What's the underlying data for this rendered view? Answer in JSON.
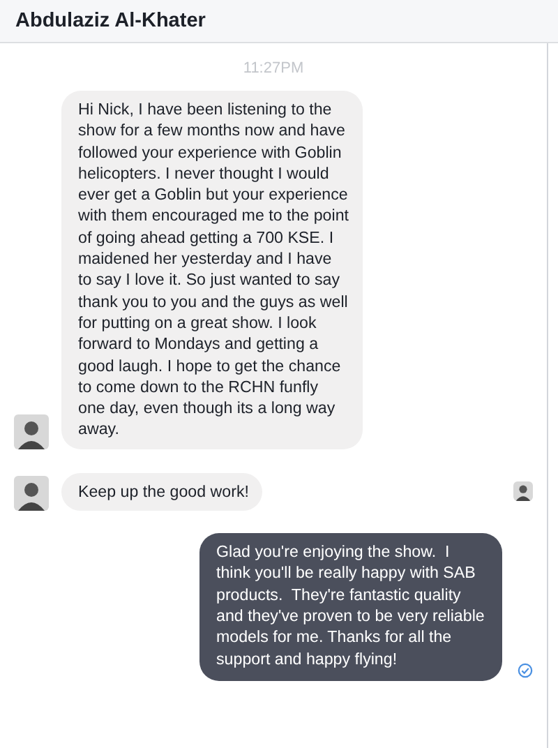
{
  "header": {
    "title": "Abdulaziz Al-Khater"
  },
  "timestamp": "11:27PM",
  "messages": [
    {
      "kind": "incoming",
      "avatar": true,
      "text": "Hi Nick, I have been listening to the show for a few months now and have followed your experience with Goblin helicopters. I never thought I would ever get a Goblin but your experience with them encouraged me to the point of going ahead getting a 700 KSE. I maidened her yesterday and I have to say I love it. So just wanted to say thank you to you and the guys as well for putting on a great show. I look forward to Mondays and getting a good laugh. I hope to get the chance to come down to the RCHN funfly one day, even though its a long way away."
    },
    {
      "kind": "incoming",
      "avatar": true,
      "seen": true,
      "text": "Keep up the good work!"
    },
    {
      "kind": "outgoing",
      "delivered": true,
      "text": "Glad you're enjoying the show.  I think you'll be really happy with SAB products.  They're fantastic quality and they've proven to be very reliable models for me. Thanks for all the support and happy flying!"
    }
  ]
}
